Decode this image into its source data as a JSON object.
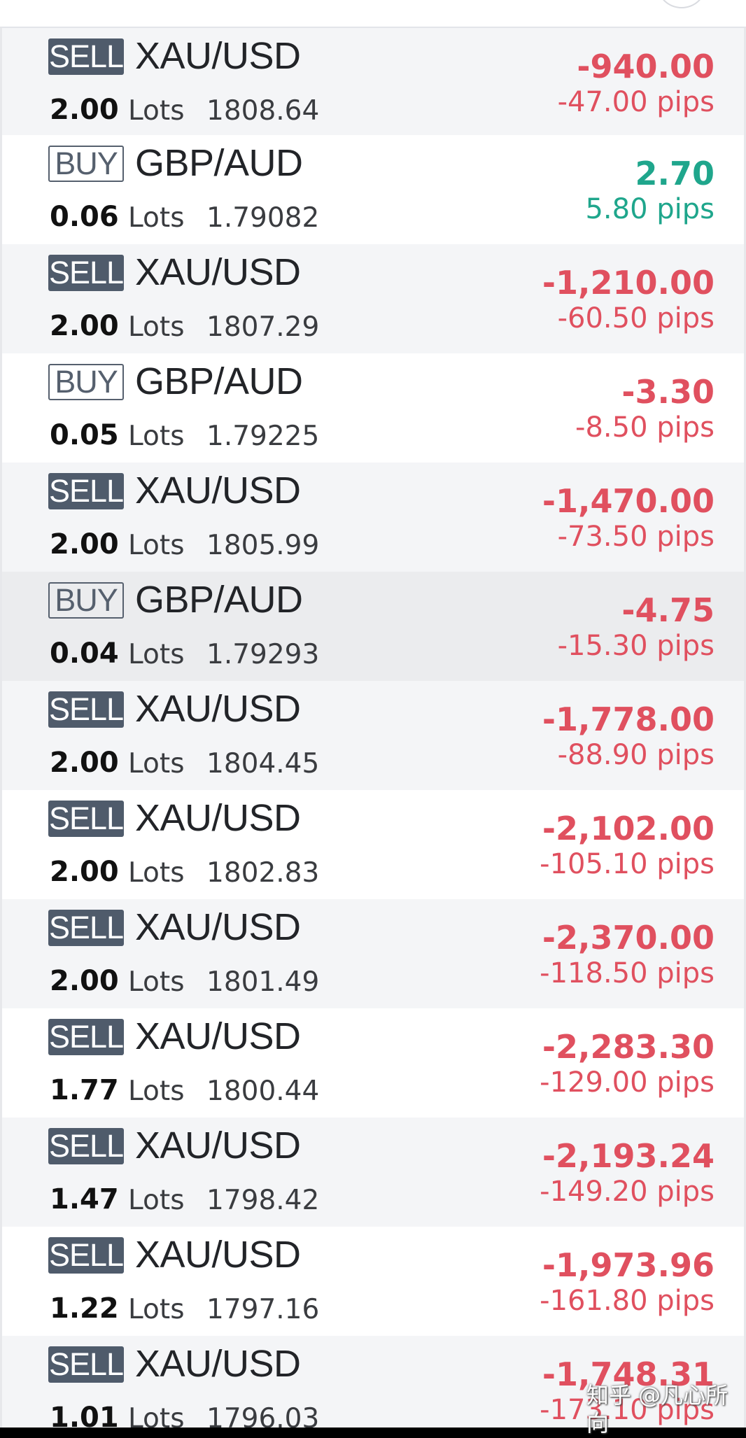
{
  "colors": {
    "sell_badge": "#4f5b6b",
    "buy_badge_border": "#56606e",
    "loss": "#e0505f",
    "gain": "#1fa68c",
    "row_alt": "#f4f5f7",
    "row_selected": "#ebecee"
  },
  "positions": [
    {
      "side": "SELL",
      "symbol": "XAU/USD",
      "lots": "2.00",
      "lots_label": "Lots",
      "price": "1808.64",
      "profit": "-940.00",
      "pips": "-47.00 pips",
      "status": "loss"
    },
    {
      "side": "BUY",
      "symbol": "GBP/AUD",
      "lots": "0.06",
      "lots_label": "Lots",
      "price": "1.79082",
      "profit": "2.70",
      "pips": "5.80 pips",
      "status": "gain"
    },
    {
      "side": "SELL",
      "symbol": "XAU/USD",
      "lots": "2.00",
      "lots_label": "Lots",
      "price": "1807.29",
      "profit": "-1,210.00",
      "pips": "-60.50 pips",
      "status": "loss"
    },
    {
      "side": "BUY",
      "symbol": "GBP/AUD",
      "lots": "0.05",
      "lots_label": "Lots",
      "price": "1.79225",
      "profit": "-3.30",
      "pips": "-8.50 pips",
      "status": "loss"
    },
    {
      "side": "SELL",
      "symbol": "XAU/USD",
      "lots": "2.00",
      "lots_label": "Lots",
      "price": "1805.99",
      "profit": "-1,470.00",
      "pips": "-73.50 pips",
      "status": "loss"
    },
    {
      "side": "BUY",
      "symbol": "GBP/AUD",
      "lots": "0.04",
      "lots_label": "Lots",
      "price": "1.79293",
      "profit": "-4.75",
      "pips": "-15.30 pips",
      "status": "loss",
      "selected": true
    },
    {
      "side": "SELL",
      "symbol": "XAU/USD",
      "lots": "2.00",
      "lots_label": "Lots",
      "price": "1804.45",
      "profit": "-1,778.00",
      "pips": "-88.90 pips",
      "status": "loss"
    },
    {
      "side": "SELL",
      "symbol": "XAU/USD",
      "lots": "2.00",
      "lots_label": "Lots",
      "price": "1802.83",
      "profit": "-2,102.00",
      "pips": "-105.10 pips",
      "status": "loss"
    },
    {
      "side": "SELL",
      "symbol": "XAU/USD",
      "lots": "2.00",
      "lots_label": "Lots",
      "price": "1801.49",
      "profit": "-2,370.00",
      "pips": "-118.50 pips",
      "status": "loss"
    },
    {
      "side": "SELL",
      "symbol": "XAU/USD",
      "lots": "1.77",
      "lots_label": "Lots",
      "price": "1800.44",
      "profit": "-2,283.30",
      "pips": "-129.00 pips",
      "status": "loss"
    },
    {
      "side": "SELL",
      "symbol": "XAU/USD",
      "lots": "1.47",
      "lots_label": "Lots",
      "price": "1798.42",
      "profit": "-2,193.24",
      "pips": "-149.20 pips",
      "status": "loss"
    },
    {
      "side": "SELL",
      "symbol": "XAU/USD",
      "lots": "1.22",
      "lots_label": "Lots",
      "price": "1797.16",
      "profit": "-1,973.96",
      "pips": "-161.80 pips",
      "status": "loss"
    },
    {
      "side": "SELL",
      "symbol": "XAU/USD",
      "lots": "1.01",
      "lots_label": "Lots",
      "price": "1796.03",
      "profit": "-1,748.31",
      "pips": "-173.10 pips",
      "status": "loss"
    }
  ],
  "watermark": "知乎 @凡心所向"
}
